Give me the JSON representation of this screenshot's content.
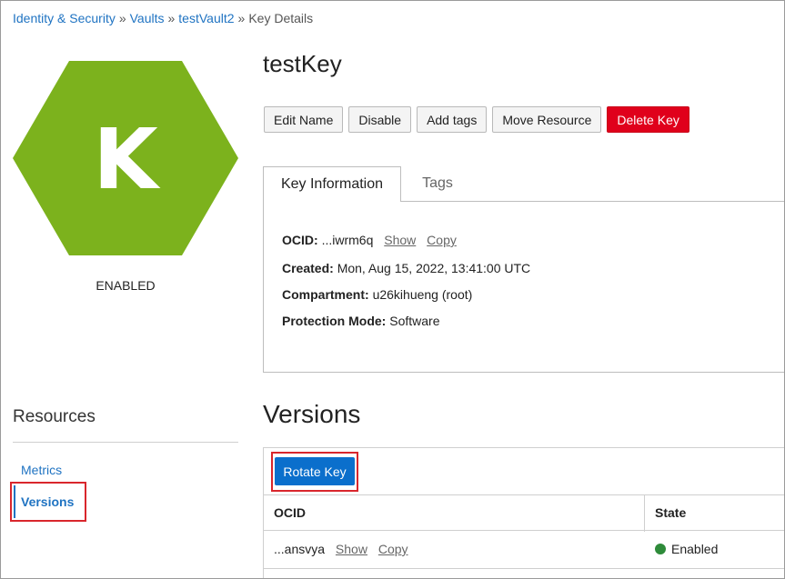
{
  "breadcrumb": {
    "items": [
      "Identity & Security",
      "Vaults",
      "testVault2"
    ],
    "current": "Key Details",
    "separator": "»"
  },
  "key_badge": {
    "letter": "K",
    "color": "#7cb21d",
    "status": "ENABLED"
  },
  "title": "testKey",
  "actions": {
    "edit_name": "Edit Name",
    "disable": "Disable",
    "add_tags": "Add tags",
    "move_resource": "Move Resource",
    "delete_key": "Delete Key"
  },
  "tabs": {
    "key_information": "Key Information",
    "tags": "Tags"
  },
  "key_info": {
    "ocid_label": "OCID:",
    "ocid_value": "...iwrm6q",
    "show": "Show",
    "copy": "Copy",
    "created_label": "Created:",
    "created_value": "Mon, Aug 15, 2022, 13:41:00 UTC",
    "compartment_label": "Compartment:",
    "compartment_value": "u26kihueng (root)",
    "protection_label": "Protection Mode:",
    "protection_value": "Software"
  },
  "resources": {
    "title": "Resources",
    "metrics": "Metrics",
    "versions": "Versions"
  },
  "versions": {
    "title": "Versions",
    "rotate_key": "Rotate Key",
    "columns": {
      "ocid": "OCID",
      "state": "State"
    },
    "rows": [
      {
        "ocid": "...ansvya",
        "show": "Show",
        "copy": "Copy",
        "state": "Enabled",
        "state_color": "#2e8b3a"
      }
    ]
  }
}
